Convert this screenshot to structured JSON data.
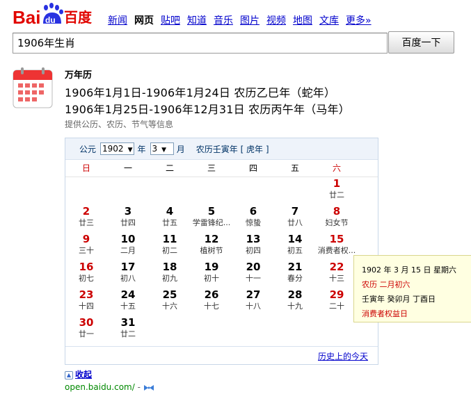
{
  "logo": {
    "text_bai": "Bai",
    "text_du": "du",
    "text_cn": "百度"
  },
  "nav": [
    {
      "label": "新闻",
      "active": false
    },
    {
      "label": "网页",
      "active": true
    },
    {
      "label": "贴吧",
      "active": false
    },
    {
      "label": "知道",
      "active": false
    },
    {
      "label": "音乐",
      "active": false
    },
    {
      "label": "图片",
      "active": false
    },
    {
      "label": "视频",
      "active": false
    },
    {
      "label": "地图",
      "active": false
    },
    {
      "label": "文库",
      "active": false
    },
    {
      "label": "更多»",
      "active": false
    }
  ],
  "search": {
    "value": "1906年生肖",
    "button": "百度一下"
  },
  "result": {
    "title": "万年历",
    "line1": "1906年1月1日-1906年1月24日 农历乙巳年（蛇年）",
    "line2": "1906年1月25日-1906年12月31日 农历丙午年（马年）",
    "desc": "提供公历、农历、节气等信息"
  },
  "calendar": {
    "era_label": "公元",
    "year_value": "1902",
    "year_label": "年",
    "month_value": "3",
    "month_label": "月",
    "lunar_year_text": "农历壬寅年",
    "zodiac_text": "[ 虎年 ]",
    "weekdays": [
      "日",
      "一",
      "二",
      "三",
      "四",
      "五",
      "六"
    ],
    "days": [
      {
        "d": "1",
        "l": "廿二",
        "col": 6,
        "row": 0
      },
      {
        "d": "2",
        "l": "廿三",
        "col": 0,
        "row": 1
      },
      {
        "d": "3",
        "l": "廿四",
        "col": 1,
        "row": 1
      },
      {
        "d": "4",
        "l": "廿五",
        "col": 2,
        "row": 1
      },
      {
        "d": "5",
        "l": "学雷锋纪...",
        "col": 3,
        "row": 1
      },
      {
        "d": "6",
        "l": "惊蛰",
        "col": 4,
        "row": 1
      },
      {
        "d": "7",
        "l": "廿八",
        "col": 5,
        "row": 1
      },
      {
        "d": "8",
        "l": "妇女节",
        "col": 6,
        "row": 1
      },
      {
        "d": "9",
        "l": "三十",
        "col": 0,
        "row": 2
      },
      {
        "d": "10",
        "l": "二月",
        "col": 1,
        "row": 2
      },
      {
        "d": "11",
        "l": "初二",
        "col": 2,
        "row": 2
      },
      {
        "d": "12",
        "l": "植树节",
        "col": 3,
        "row": 2
      },
      {
        "d": "13",
        "l": "初四",
        "col": 4,
        "row": 2
      },
      {
        "d": "14",
        "l": "初五",
        "col": 5,
        "row": 2
      },
      {
        "d": "15",
        "l": "消费者权...",
        "col": 6,
        "row": 2
      },
      {
        "d": "16",
        "l": "初七",
        "col": 0,
        "row": 3
      },
      {
        "d": "17",
        "l": "初八",
        "col": 1,
        "row": 3
      },
      {
        "d": "18",
        "l": "初九",
        "col": 2,
        "row": 3
      },
      {
        "d": "19",
        "l": "初十",
        "col": 3,
        "row": 3
      },
      {
        "d": "20",
        "l": "十一",
        "col": 4,
        "row": 3
      },
      {
        "d": "21",
        "l": "春分",
        "col": 5,
        "row": 3
      },
      {
        "d": "22",
        "l": "十三",
        "col": 6,
        "row": 3
      },
      {
        "d": "23",
        "l": "十四",
        "col": 0,
        "row": 4
      },
      {
        "d": "24",
        "l": "十五",
        "col": 1,
        "row": 4
      },
      {
        "d": "25",
        "l": "十六",
        "col": 2,
        "row": 4
      },
      {
        "d": "26",
        "l": "十七",
        "col": 3,
        "row": 4
      },
      {
        "d": "27",
        "l": "十八",
        "col": 4,
        "row": 4
      },
      {
        "d": "28",
        "l": "十九",
        "col": 5,
        "row": 4
      },
      {
        "d": "29",
        "l": "二十",
        "col": 6,
        "row": 4
      },
      {
        "d": "30",
        "l": "廿一",
        "col": 0,
        "row": 5
      },
      {
        "d": "31",
        "l": "廿二",
        "col": 1,
        "row": 5
      }
    ],
    "history_link": "历史上的今天"
  },
  "tooltip": {
    "line1": "1902 年 3 月 15 日 星期六",
    "line2": "农历 二月初六",
    "line3": "壬寅年 癸卯月 丁酉日",
    "line4": "消费者权益日"
  },
  "collapse_label": "收起",
  "source": {
    "url": "open.baidu.com/",
    "sep": "-"
  },
  "colors": {
    "weekend": "#cc0000",
    "link": "#0000cc",
    "green": "#008000",
    "tooltip_bg": "#ffffe1"
  }
}
